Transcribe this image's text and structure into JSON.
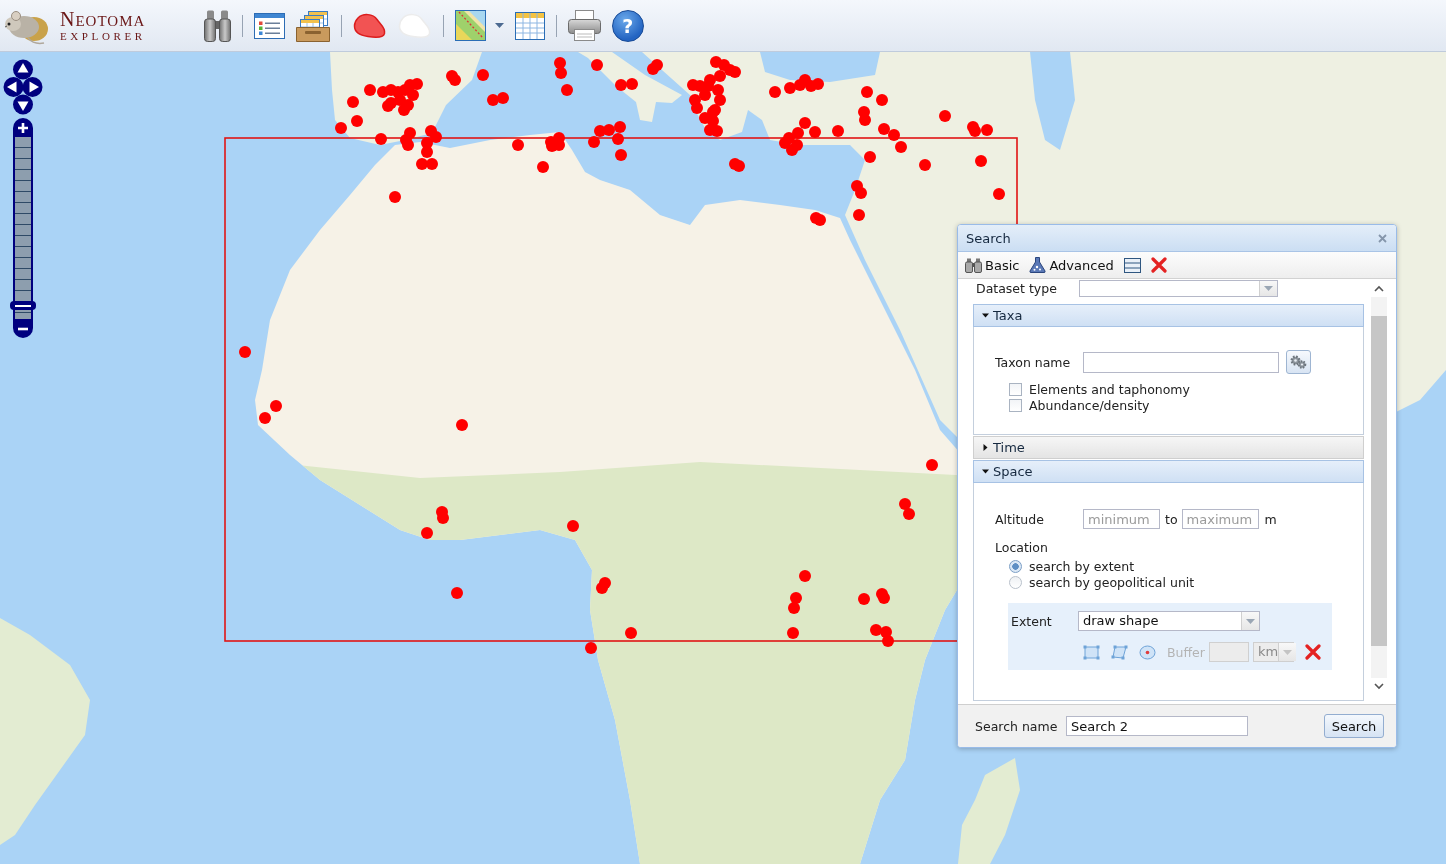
{
  "toolbar": {
    "logo": {
      "title": "NEOTOMA",
      "subtitle": "EXPLORER"
    },
    "tool_groups": [
      [
        {
          "kind": "binoculars"
        }
      ],
      [
        {
          "kind": "list"
        },
        {
          "kind": "trays"
        }
      ],
      [
        {
          "kind": "red-blob"
        },
        {
          "kind": "white-blob"
        }
      ],
      [
        {
          "kind": "map",
          "menu": true
        },
        {
          "kind": "table"
        }
      ],
      [
        {
          "kind": "printer"
        },
        {
          "kind": "help",
          "symbol": "?"
        }
      ]
    ]
  },
  "map": {
    "zoom": {
      "level": 0.07
    }
  },
  "search_window": {
    "title": "Search",
    "toolbar": [
      {
        "kind": "basic",
        "label": "Basic"
      },
      {
        "kind": "advanced",
        "label": "Advanced"
      },
      {
        "kind": "rows"
      },
      {
        "kind": "clear"
      }
    ],
    "dataset_type": {
      "label": "Dataset type"
    },
    "sections": [
      {
        "kind": "taxa",
        "title": "Taxa",
        "expanded": true,
        "taxon_name": {
          "label": "Taxon name"
        },
        "options": [
          {
            "label": "Elements and taphonomy",
            "checked": false
          },
          {
            "label": "Abundance/density",
            "checked": false
          }
        ]
      },
      {
        "kind": "time",
        "title": "Time",
        "expanded": false
      },
      {
        "kind": "space",
        "title": "Space",
        "expanded": true,
        "altitude": {
          "label": "Altitude",
          "min_placeholder": "minimum",
          "separator": "to",
          "max_placeholder": "maximum",
          "unit": "m"
        },
        "location": {
          "label": "Location",
          "options": [
            {
              "label": "search by extent",
              "selected": true
            },
            {
              "label": "search by geopolitical unit",
              "selected": false
            }
          ]
        },
        "extent": {
          "label": "Extent",
          "value": "draw shape",
          "tools": [
            {
              "kind": "rectangle"
            },
            {
              "kind": "polygon"
            },
            {
              "kind": "circle"
            }
          ],
          "buffer": {
            "label": "Buffer",
            "unit": "km",
            "disabled": true
          }
        }
      }
    ],
    "search_name": {
      "label": "Search name",
      "value": "Search 2"
    },
    "submit": "Search"
  }
}
